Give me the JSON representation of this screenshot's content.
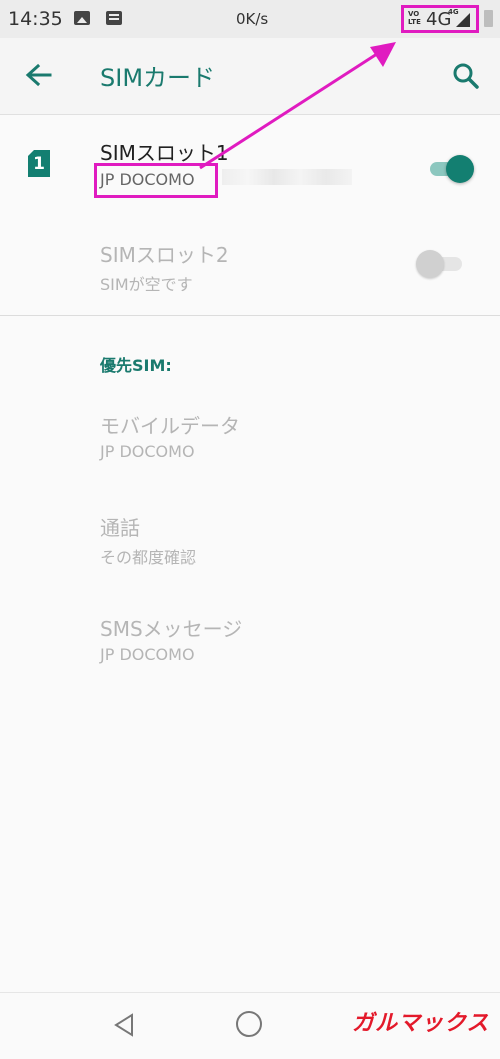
{
  "status_bar": {
    "time": "14:35",
    "speed": "0K/s",
    "volte_label": "VO\nLTE",
    "network": "4G",
    "network_small": "4G"
  },
  "app_bar": {
    "title": "SIMカード"
  },
  "sim_slot_1": {
    "badge": "1",
    "title": "SIMスロット1",
    "carrier": "JP DOCOMO",
    "enabled": true
  },
  "sim_slot_2": {
    "title": "SIMスロット2",
    "subtitle": "SIMが空です",
    "enabled": false
  },
  "preferred_sim": {
    "header": "優先SIM:",
    "items": [
      {
        "title": "モバイルデータ",
        "value": "JP DOCOMO"
      },
      {
        "title": "通話",
        "value": "その都度確認"
      },
      {
        "title": "SMSメッセージ",
        "value": "JP DOCOMO"
      }
    ]
  },
  "watermark": "ガルマックス",
  "colors": {
    "accent": "#137f71",
    "annotation": "#e01bc0"
  }
}
